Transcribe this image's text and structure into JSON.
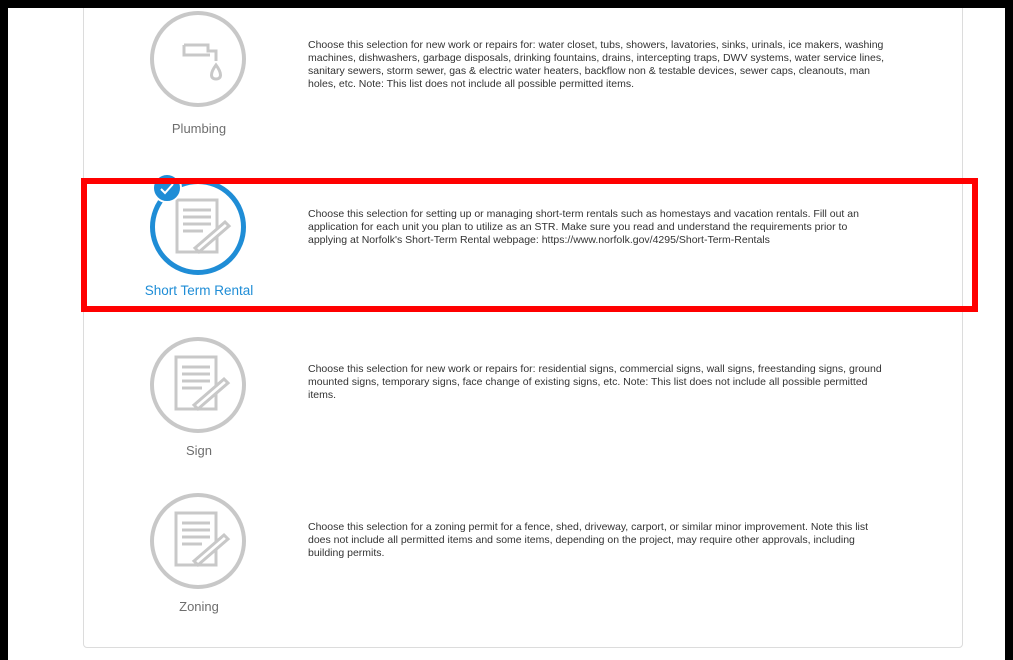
{
  "options": [
    {
      "label": "Plumbing",
      "icon": "faucet-icon",
      "selected": false,
      "description": "Choose this selection for new work or repairs for: water closet, tubs, showers, lavatories, sinks, urinals, ice makers, washing machines, dishwashers, garbage disposals, drinking fountains, drains, intercepting traps, DWV systems, water service lines, sanitary sewers, storm sewer, gas & electric water heaters, backflow non & testable devices, sewer caps, cleanouts, man holes, etc. Note: This list does not include all possible permitted items."
    },
    {
      "label": "Short Term Rental",
      "icon": "document-pen-icon",
      "selected": true,
      "description": "Choose this selection for setting up or managing short-term rentals such as homestays and vacation rentals. Fill out an application for each unit you plan to utilize as an STR. Make sure you read and understand the requirements prior to applying at Norfolk's Short-Term Rental webpage: https://www.norfolk.gov/4295/Short-Term-Rentals"
    },
    {
      "label": "Sign",
      "icon": "document-pen-icon",
      "selected": false,
      "description": "Choose this selection for new work or repairs for: residential signs, commercial signs, wall signs, freestanding signs, ground mounted signs, temporary signs, face change of existing signs, etc. Note: This list does not include all possible permitted items."
    },
    {
      "label": "Zoning",
      "icon": "document-pen-icon",
      "selected": false,
      "description": "Choose this selection for a zoning permit for a fence, shed, driveway, carport, or similar minor improvement. Note this list does not include all permitted items and some items, depending on the project, may require other approvals, including building permits."
    }
  ],
  "colors": {
    "accent": "#1f8dd6",
    "highlight": "#ff0000",
    "icon_gray": "#c8c8c8"
  }
}
